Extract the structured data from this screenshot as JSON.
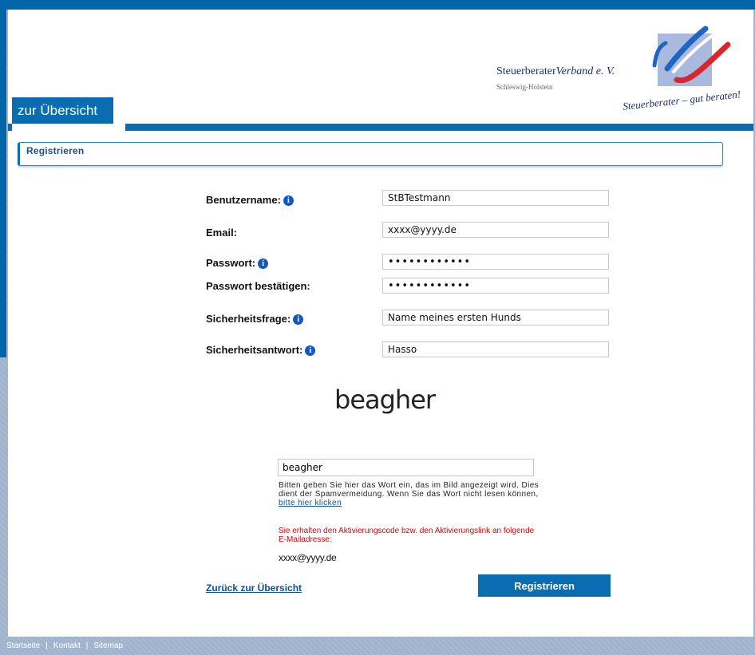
{
  "header": {
    "nav_tab": "zur Übersicht",
    "logo": {
      "title_plain": "Steuerberater",
      "title_italic": "Verband e. V.",
      "subtitle": "Schleswig-Holstein",
      "tagline": "Steuerberater – gut beraten!"
    }
  },
  "section": {
    "title": "Registrieren"
  },
  "form": {
    "username": {
      "label": "Benutzername:",
      "value": "StBTestmann",
      "info_icon": "info-icon"
    },
    "email": {
      "label": "Email:",
      "value": "xxxx@yyyy.de"
    },
    "password": {
      "label": "Passwort:",
      "value": "••••••••••••",
      "info_icon": "info-icon"
    },
    "password_confirm": {
      "label": "Passwort bestätigen:",
      "value": "••••••••••••"
    },
    "security_question": {
      "label": "Sicherheitsfrage:",
      "value": "Name meines ersten Hunds",
      "info_icon": "info-icon"
    },
    "security_answer": {
      "label": "Sicherheitsantwort:",
      "value": "Hasso",
      "info_icon": "info-icon"
    }
  },
  "captcha": {
    "image_text": "beagher",
    "input_value": "beagher",
    "help_text": "Bitten geben Sie hier das Wort ein, das im Bild angezeigt wird. Dies dient der Spamvermeidung. Wenn Sie das Wort nicht lesen können,",
    "help_link": "bitte hier klicken"
  },
  "activation": {
    "notice": "Sie erhalten den Aktivierungscode bzw. den Aktivierungslink an folgende E-Mailadresse:",
    "email": "xxxx@yyyy.de"
  },
  "actions": {
    "back_link": "Zurück zur Übersicht",
    "register_button": "Registrieren"
  },
  "footer": {
    "links": [
      "Startseite",
      "Kontakt",
      "Sitemap"
    ]
  },
  "colors": {
    "brand_blue": "#0a6db2",
    "warning_red": "#e00000",
    "logo_red": "#d8262c",
    "logo_blue": "#1f66c2"
  }
}
